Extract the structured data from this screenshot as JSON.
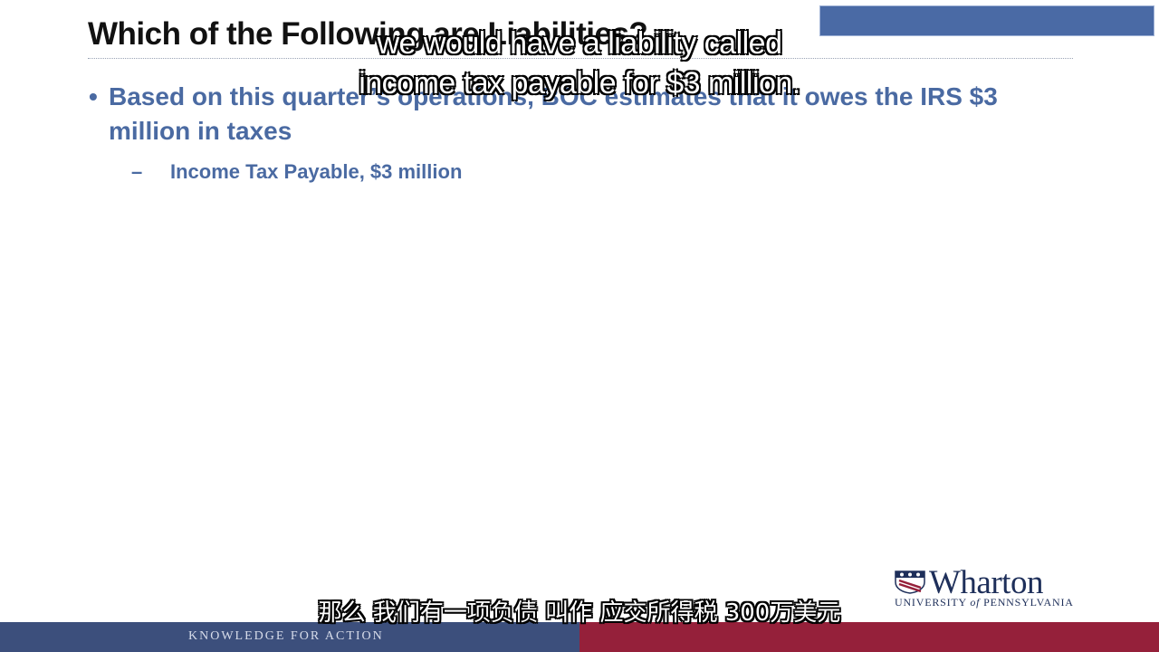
{
  "slide": {
    "title": "Which of the Following are Liabilities?",
    "bullet": "Based on this quarter’s operations, BOC estimates that it owes the IRS $3 million in taxes",
    "bullet_marker": "•",
    "sub_bullet_marker": "–",
    "sub_bullet": "Income Tax Payable, $3 million"
  },
  "subtitles": {
    "english_line1": "we would have a liability called",
    "english_line2": "income tax payable for $3 million.",
    "chinese": "那么 我们有一项负债 叫作 应交所得税 300万美元"
  },
  "branding": {
    "logo_word": "Wharton",
    "logo_sub_prefix": "UNIVERSITY ",
    "logo_sub_of": "of",
    "logo_sub_suffix": " PENNSYLVANIA",
    "footer_tagline": "KNOWLEDGE FOR ACTION"
  },
  "colors": {
    "bullet_text": "#4a6aa2",
    "footer_blue": "#3c4f7c",
    "footer_red": "#95203a",
    "header_box": "#4a6aa5"
  }
}
